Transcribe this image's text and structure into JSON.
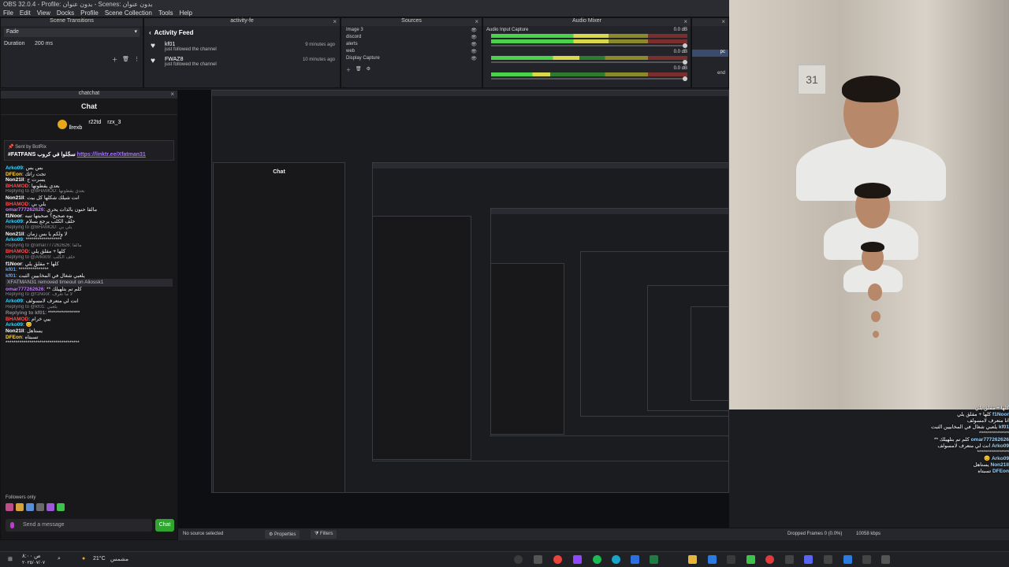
{
  "window": {
    "title": "OBS 32.0.4 - Profile: بدون عنوان - Scenes: بدون عنوان",
    "menus": [
      "File",
      "Edit",
      "View",
      "Docks",
      "Profile",
      "Scene Collection",
      "Tools",
      "Help"
    ]
  },
  "transitions": {
    "header": "Scene Transitions",
    "type": "Fade",
    "duration_label": "Duration",
    "duration_value": "200 ms"
  },
  "activity": {
    "dock_title": "activity-fe",
    "title": "Activity Feed",
    "items": [
      {
        "user": "kf01",
        "action": "just followed the channel",
        "time": "9 minutes ago"
      },
      {
        "user": "FWAZ8",
        "action": "just followed the channel",
        "time": "10 minutes ago"
      }
    ]
  },
  "sources": {
    "header": "Sources",
    "items": [
      {
        "left": "Image 3",
        "right": ""
      },
      {
        "left": "discord",
        "right": ""
      },
      {
        "left": "alerts",
        "right": ""
      },
      {
        "left": "web",
        "right": ""
      },
      {
        "left": "Display Capture",
        "right": ""
      }
    ]
  },
  "mixer": {
    "header": "Audio Mixer",
    "channels": [
      {
        "name": "Audio Input Capture",
        "db": "0.0 dB",
        "level": 0.6
      },
      {
        "name": "",
        "db": "0.0 dB",
        "level": 0.45
      },
      {
        "name": "",
        "db": "0.0 dB",
        "level": 0.3
      }
    ]
  },
  "scenes": {
    "items": [
      "pc",
      "end"
    ],
    "active": "pc"
  },
  "chat": {
    "dock_title": "chatchat",
    "title": "Chat",
    "leaderboard": [
      "llrexb",
      "r22td",
      "rzx_3"
    ],
    "pinned_by": "Sent by BotRix",
    "pinned_text": "#FATFANS سجّلوا في كروب",
    "pinned_link": "https://linktr.ee/Xfatman31",
    "messages": [
      {
        "user": "Arko09",
        "text": ": بس بس",
        "color": "#39d3ff"
      },
      {
        "user": "DFEon",
        "text": ": تجت راتك",
        "color": "#ffd33c"
      },
      {
        "user": "Non21ll",
        "text": ": يسرت ج",
        "color": "#ffffff"
      },
      {
        "user": "BHAMOD",
        "text": ": بعدي يقطونها",
        "color": "#ff4b4b"
      },
      {
        "reply": "Replying to @BHAMOD: بعدي يقطونها"
      },
      {
        "user": "Non21ll",
        "text": ": انت شيلك شكلها كل بيت",
        "color": "#ffffff"
      },
      {
        "user": "BHAMOD",
        "text": ": يلي بي",
        "color": "#ff4b4b"
      },
      {
        "user": "omar777262626",
        "text": ": مالقا حنون بالذات يحري",
        "color": "#c678ff"
      },
      {
        "user": "f1Noor",
        "text": ": يوه صحيح؟ صحبتها تنبه",
        "color": "#ffffff"
      },
      {
        "user": "Arko09",
        "text": ": خلف الكلب يرجع بسلام",
        "color": "#39d3ff"
      },
      {
        "reply": "Replying to @BHAMOD: يلي بي"
      },
      {
        "user": "Non21ll",
        "text": ": لا ولكم يا بس زمان",
        "color": "#ffffff"
      },
      {
        "user": "Arko09",
        "text": ": ******************",
        "color": "#39d3ff"
      },
      {
        "reply": "Replying to @omar777262626: مالقا"
      },
      {
        "user": "BHAMOD",
        "text": ": كلها + مقلق يلي",
        "color": "#ff4b4b"
      },
      {
        "reply": "Replying to @Arko09: خلف الكلب"
      },
      {
        "user": "f1Noor",
        "text": ": كلها + مقلق يلي",
        "color": "#ffffff"
      },
      {
        "user": "kf01",
        "text": ": ***************",
        "color": "#5aa7ff"
      },
      {
        "user": "kf01",
        "text": ": يلعبي شغال في المخابيين الثبت",
        "color": "#5aa7ff"
      },
      {
        "sys": "XFATMAN31 removed timeout on Aliossk1"
      },
      {
        "user": "omar777262626",
        "text": ": ** كلم تم بتلهيلك",
        "color": "#c678ff"
      },
      {
        "reply": "Replying to @f1Noor: لا ما تعرف"
      },
      {
        "user": "Arko09",
        "text": ": انت لي متعرف لامسولف",
        "color": "#39d3ff"
      },
      {
        "reply": "Replying to @kf01: يلعبي"
      },
      {
        "user": "Replying to kf01",
        "text": ": ****************",
        "color": "#8a8a8f"
      },
      {
        "user": "BHAMOD",
        "text": ": ييي خرام",
        "color": "#ff4b4b"
      },
      {
        "user": "Arko09",
        "text": ": 😊",
        "color": "#39d3ff"
      },
      {
        "user": "Non21ll",
        "text": ": يستاهل",
        "color": "#ffffff"
      },
      {
        "user": "DFEon",
        "text": ": تسبتاه",
        "color": "#ffd33c"
      },
      {
        "user": "",
        "text": "*************************************",
        "color": "#ffffff"
      }
    ],
    "followers_only": "Followers only",
    "input_placeholder": "Send a message",
    "send_label": "Chat"
  },
  "preview": {
    "nested_title": "Chat"
  },
  "overlay_chat": [
    {
      "user": "",
      "text": "كلها + مقلق يلي"
    },
    {
      "user": "f1Noor",
      "text": "كلها + مقلق يلي"
    },
    {
      "user": "",
      "text": "انا متعرف لامسولف"
    },
    {
      "user": "kf01",
      "text": "يلعبي شغال في المخابيين الثبت"
    },
    {
      "user": "",
      "text": "***************"
    },
    {
      "user": "omar777262626",
      "text": "** كلم تم بتلهيلك"
    },
    {
      "user": "Arko09",
      "text": "انت لي متعرف لامسولف"
    },
    {
      "user": "",
      "text": "****************"
    },
    {
      "user": "Arko09",
      "text": "😊"
    },
    {
      "user": "Non21ll",
      "text": "يستاهل"
    },
    {
      "user": "DFEon",
      "text": "تسبتاه"
    }
  ],
  "status": {
    "no_source": "No source selected",
    "properties": "Properties",
    "filters": "Filters",
    "dropped": "Dropped Frames 0 (0.0%)",
    "bitrate": "10058 kbps"
  },
  "taskbar": {
    "weather": "21°C",
    "weather_text": "مشمس",
    "clock": "ص ٨:٠٠",
    "date": "٢٠٢٥/٠٧/٠٧"
  },
  "webcam": {
    "calendar_number": "31"
  },
  "colors": {
    "accent_green": "#3fc24a",
    "twitch_purple": "#a970ff",
    "chat_bg": "#18181b"
  }
}
